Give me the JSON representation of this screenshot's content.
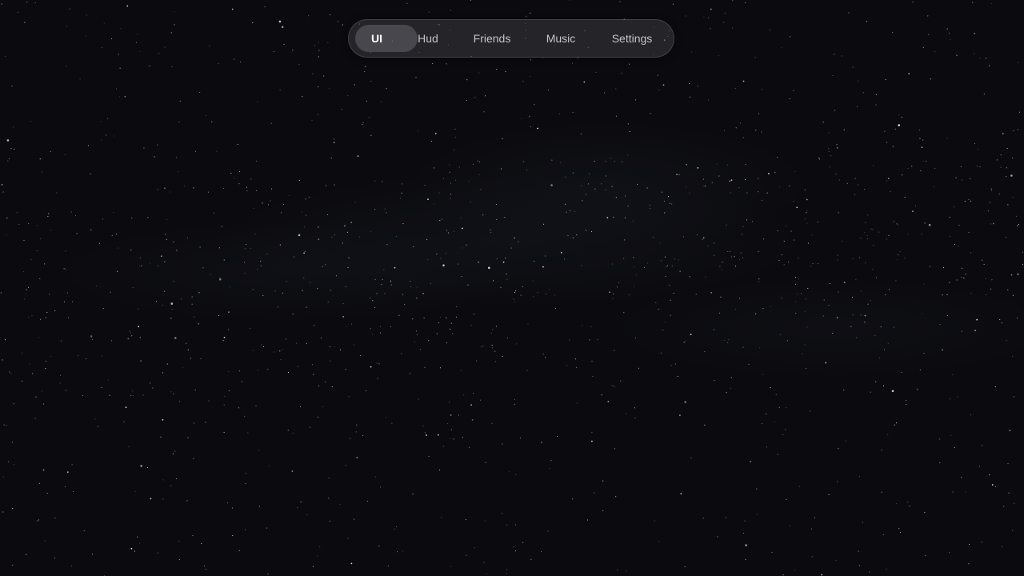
{
  "background": {
    "scene": "night-sky-starfield",
    "base_color": "#0b0b0f",
    "star_color": "#dfe6ee"
  },
  "nav": {
    "active_tab": "UI",
    "accent_color": "#ffffff",
    "tabs": [
      {
        "label": "UI",
        "active": true
      },
      {
        "label": "Hud",
        "active": false
      },
      {
        "label": "Friends",
        "active": false
      },
      {
        "label": "Music",
        "active": false
      },
      {
        "label": "Settings",
        "active": false
      }
    ]
  }
}
